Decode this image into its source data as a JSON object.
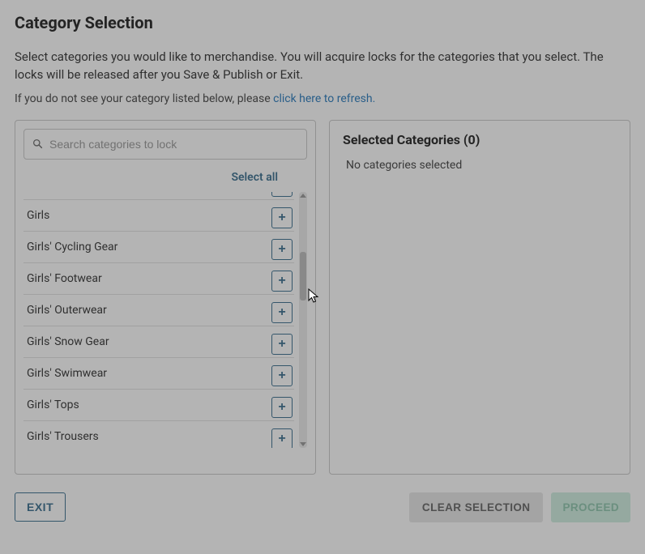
{
  "title": "Category Selection",
  "description": "Select categories you would like to merchandise. You will acquire locks for the categories that you select. The locks will be released after you Save & Publish or Exit.",
  "refresh_prefix": "If you do not see your category listed below, please ",
  "refresh_link": "click here to refresh.",
  "search": {
    "placeholder": "Search categories to lock",
    "value": ""
  },
  "select_all_label": "Select all",
  "categories": [
    {
      "label": "Girls"
    },
    {
      "label": "Girls' Cycling Gear"
    },
    {
      "label": "Girls' Footwear"
    },
    {
      "label": "Girls' Outerwear"
    },
    {
      "label": "Girls' Snow Gear"
    },
    {
      "label": "Girls' Swimwear"
    },
    {
      "label": "Girls' Tops"
    },
    {
      "label": "Girls' Trousers"
    }
  ],
  "add_button_label": "+",
  "selected_panel": {
    "title": "Selected Categories (0)",
    "empty": "No categories selected"
  },
  "footer": {
    "exit": "EXIT",
    "clear": "CLEAR SELECTION",
    "proceed": "PROCEED"
  }
}
